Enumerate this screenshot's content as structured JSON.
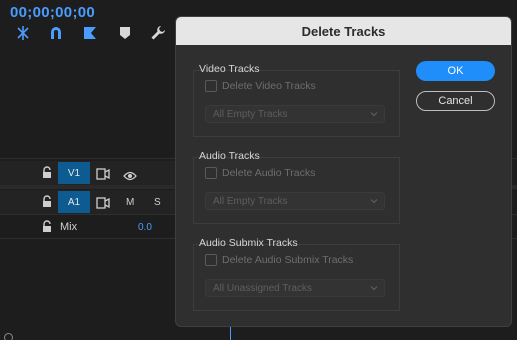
{
  "timeline": {
    "timecode": "00;00;00;00",
    "tools": [
      "snap-icon",
      "linked-selection-icon",
      "add-marker-icon",
      "marker-icon",
      "wrench-icon"
    ],
    "tracks": [
      {
        "name": "V1",
        "type": "video"
      },
      {
        "name": "A1",
        "type": "audio",
        "m": "M",
        "s": "S"
      }
    ],
    "mix": {
      "label": "Mix",
      "value": "0.0"
    }
  },
  "dialog": {
    "title": "Delete Tracks",
    "video": {
      "group_label": "Video Tracks",
      "checkbox_label": "Delete Video Tracks",
      "select_value": "All Empty Tracks",
      "checked": false
    },
    "audio": {
      "group_label": "Audio Tracks",
      "checkbox_label": "Delete Audio Tracks",
      "select_value": "All Empty Tracks",
      "checked": false
    },
    "submix": {
      "group_label": "Audio Submix Tracks",
      "checkbox_label": "Delete Audio Submix Tracks",
      "select_value": "All Unassigned Tracks",
      "checked": false
    },
    "ok_label": "OK",
    "cancel_label": "Cancel"
  },
  "colors": {
    "accent": "#1f8efa",
    "track_button": "#0e5b92",
    "timecode": "#4b9cff"
  }
}
